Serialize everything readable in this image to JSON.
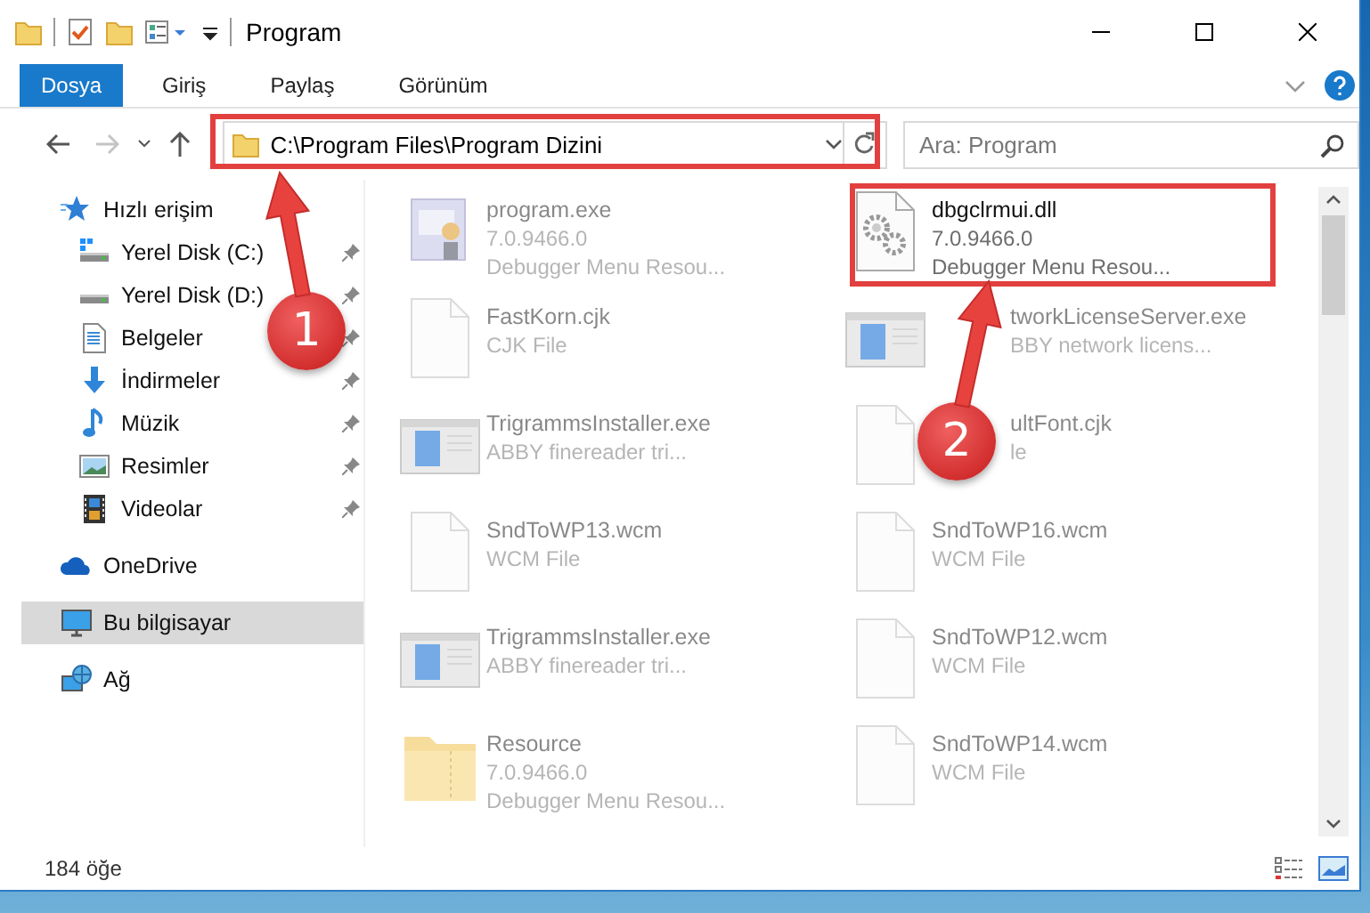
{
  "window": {
    "title": "Program"
  },
  "ribbon": {
    "tabs": [
      {
        "label": "Dosya",
        "selected": true
      },
      {
        "label": "Giriş",
        "selected": false
      },
      {
        "label": "Paylaş",
        "selected": false
      },
      {
        "label": "Görünüm",
        "selected": false
      }
    ]
  },
  "address_bar": {
    "path": "C:\\Program Files\\Program Dizini"
  },
  "search": {
    "placeholder": "Ara: Program"
  },
  "sidebar": {
    "items": [
      {
        "label": "Hızlı erişim",
        "kind": "star",
        "selected": false,
        "children": [
          {
            "label": "Yerel Disk (C:)",
            "kind": "drive-win",
            "pinned": true,
            "selected": false
          },
          {
            "label": "Yerel Disk (D:)",
            "kind": "drive",
            "pinned": true,
            "selected": false
          },
          {
            "label": "Belgeler",
            "kind": "documents",
            "pinned": true,
            "selected": false
          },
          {
            "label": "İndirmeler",
            "kind": "download",
            "pinned": true,
            "selected": false
          },
          {
            "label": "Müzik",
            "kind": "music",
            "pinned": true,
            "selected": false
          },
          {
            "label": "Resimler",
            "kind": "pictures",
            "pinned": true,
            "selected": false
          },
          {
            "label": "Videolar",
            "kind": "videos",
            "pinned": true,
            "selected": false
          }
        ]
      },
      {
        "label": "OneDrive",
        "kind": "cloud",
        "selected": false
      },
      {
        "label": "Bu bilgisayar",
        "kind": "computer",
        "selected": true
      },
      {
        "label": "Ağ",
        "kind": "network",
        "selected": false
      }
    ]
  },
  "files": [
    {
      "name": "program.exe",
      "details": [
        "7.0.9466.0",
        "Debugger Menu Resou..."
      ],
      "kind": "program",
      "blurred": true,
      "partly_covered": false
    },
    {
      "name": "dbgclrmui.dll",
      "details": [
        "7.0.9466.0",
        "Debugger Menu Resou..."
      ],
      "kind": "dll",
      "blurred": false,
      "partly_covered": false
    },
    {
      "name": "FastKorn.cjk",
      "details": [
        "CJK File"
      ],
      "kind": "page",
      "blurred": true,
      "partly_covered": false
    },
    {
      "name": "tworkLicenseServer.exe",
      "details": [
        "BBY network licens..."
      ],
      "kind": "app",
      "blurred": true,
      "partly_covered": true
    },
    {
      "name": "TrigrammsInstaller.exe",
      "details": [
        "ABBY finereader tri..."
      ],
      "kind": "app",
      "blurred": true,
      "partly_covered": false
    },
    {
      "name": "ultFont.cjk",
      "details": [
        "le"
      ],
      "kind": "page",
      "blurred": true,
      "partly_covered": true
    },
    {
      "name": "SndToWP13.wcm",
      "details": [
        "WCM File"
      ],
      "kind": "page",
      "blurred": true,
      "partly_covered": false
    },
    {
      "name": "SndToWP16.wcm",
      "details": [
        "WCM File"
      ],
      "kind": "page",
      "blurred": true,
      "partly_covered": false
    },
    {
      "name": "TrigrammsInstaller.exe",
      "details": [
        "ABBY finereader tri..."
      ],
      "kind": "app",
      "blurred": true,
      "partly_covered": false
    },
    {
      "name": "SndToWP12.wcm",
      "details": [
        "WCM File"
      ],
      "kind": "page",
      "blurred": true,
      "partly_covered": false
    },
    {
      "name": "Resource",
      "details": [
        "7.0.9466.0",
        "Debugger Menu Resou..."
      ],
      "kind": "folder",
      "blurred": true,
      "partly_covered": false
    },
    {
      "name": "SndToWP14.wcm",
      "details": [
        "WCM File"
      ],
      "kind": "page",
      "blurred": true,
      "partly_covered": false
    }
  ],
  "status_bar": {
    "item_count": "184 öğe"
  },
  "annotations": [
    {
      "kind": "address",
      "number": "1"
    },
    {
      "kind": "file",
      "number": "2"
    }
  ]
}
